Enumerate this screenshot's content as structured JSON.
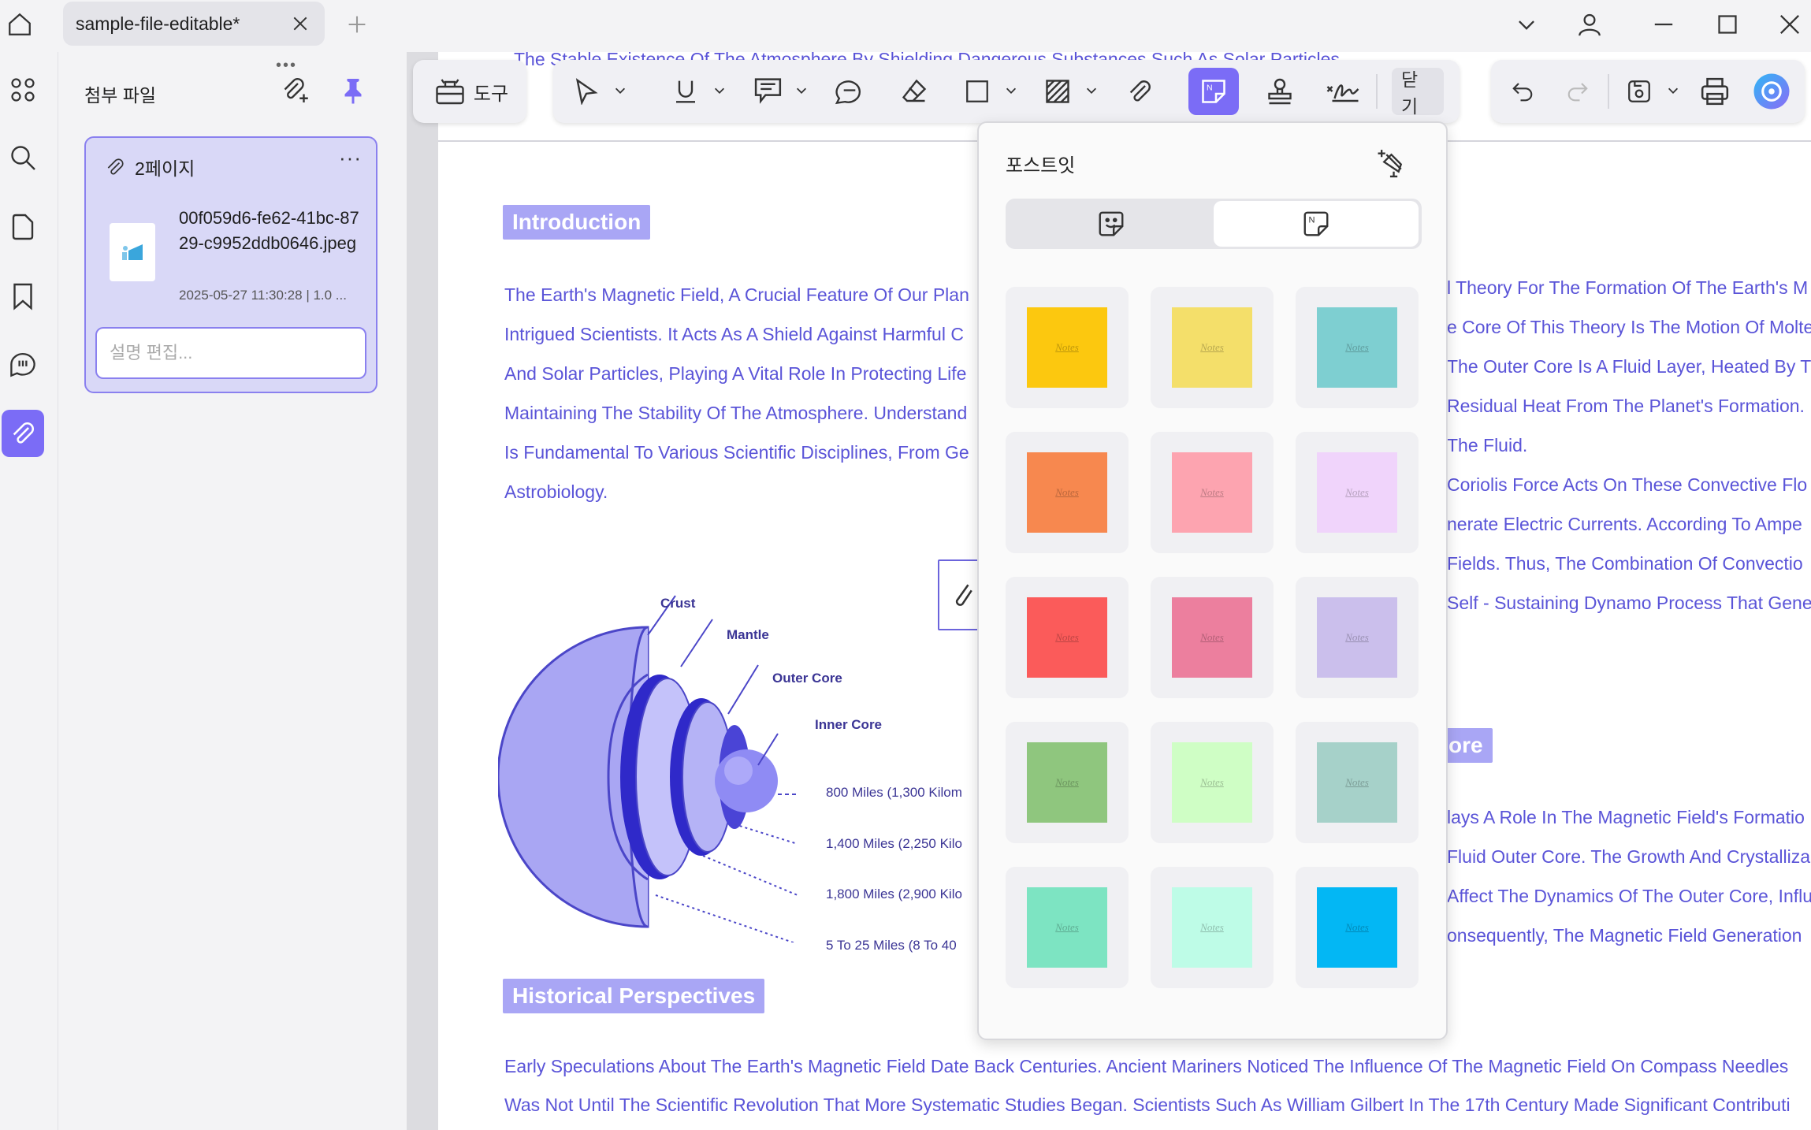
{
  "titlebar": {
    "tab_label": "sample-file-editable*"
  },
  "panel": {
    "title": "첨부 파일",
    "card": {
      "page_label": "2페이지",
      "more": "···",
      "file_name": "00f059d6-fe62-41bc-8729-c9952ddb0646.jpeg",
      "file_meta": "2025-05-27 11:30:28 | 1.0 ...",
      "desc_placeholder": "설명 편집..."
    }
  },
  "toolbar": {
    "tools_label": "도구",
    "close_label": "닫기"
  },
  "sticky_popup": {
    "title": "포스트잇",
    "note_text": "Notes",
    "colors": [
      "#fcc80f",
      "#f4df6a",
      "#7ecfd1",
      "#f7884f",
      "#fda4b0",
      "#f0d4fb",
      "#fb5b5a",
      "#ec7f9e",
      "#cbbfec",
      "#8fc67e",
      "#cffec5",
      "#a6d1c9",
      "#7de4c2",
      "#befce7",
      "#03b7f4"
    ]
  },
  "document": {
    "top_cut": "The Stable Existence Of The Atmosphere By Shielding Dangerous Substances Such As Solar Particles",
    "intro_heading": "Introduction",
    "intro_lines": [
      "The Earth's Magnetic Field, A Crucial Feature Of Our Plan",
      "Intrigued Scientists. It Acts As A Shield Against Harmful C",
      "And Solar Particles, Playing A Vital Role In Protecting Life",
      "Maintaining The Stability Of The Atmosphere. Understand",
      "Is Fundamental To Various Scientific Disciplines, From Ge",
      "Astrobiology."
    ],
    "right_lines": [
      "l Theory For The Formation Of The Earth's M",
      "e Core Of This Theory Is The Motion Of Molte",
      "The Outer Core Is A Fluid Layer, Heated By T",
      "Residual Heat From The Planet's Formation.",
      "The Fluid.",
      "Coriolis Force Acts On These Convective Flo",
      "nerate Electric Currents. According To Ampe",
      "Fields. Thus, The Combination Of Convectio",
      "Self - Sustaining Dynamo Process That Gene"
    ],
    "core_heading": "ore",
    "right_lines2": [
      "lays A Role In The Magnetic Field's Formatio",
      "Fluid Outer Core. The Growth And Crystalliza",
      "Affect The Dynamics Of The Outer Core, Influ",
      "onsequently, The Magnetic Field Generation"
    ],
    "earth_labels": [
      "Crust",
      "Mantle",
      "Outer Core",
      "Inner Core"
    ],
    "depth_labels": [
      "800 Miles (1,300 Kilom",
      "1,400 Miles (2,250 Kilo",
      "1,800 Miles (2,900 Kilo",
      "5 To 25 Miles (8 To 40"
    ],
    "hist_heading": "Historical Perspectives",
    "hist_lines": [
      "Early Speculations About The Earth's Magnetic Field Date Back Centuries. Ancient Mariners Noticed The Influence Of The Magnetic Field On Compass Needles",
      "Was Not Until The Scientific Revolution That More Systematic Studies Began. Scientists Such As William Gilbert In The 17th Century Made Significant Contributi"
    ]
  }
}
